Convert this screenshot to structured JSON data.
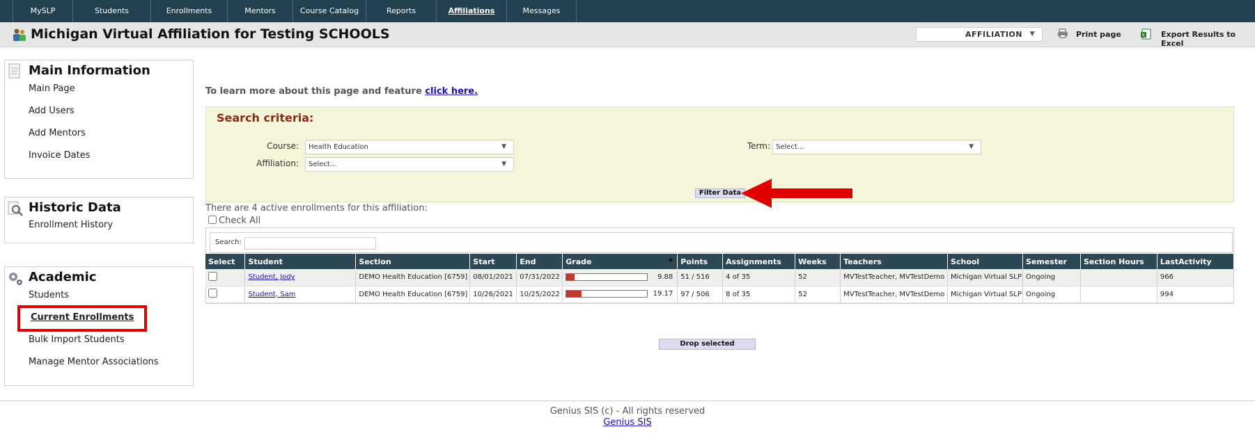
{
  "nav": {
    "tabs": [
      {
        "label": "MySLP"
      },
      {
        "label": "Students"
      },
      {
        "label": "Enrollments"
      },
      {
        "label": "Mentors"
      },
      {
        "label": "Course Catalog"
      },
      {
        "label": "Reports"
      },
      {
        "label": "Affiliations",
        "active": true
      },
      {
        "label": "Messages"
      }
    ]
  },
  "header": {
    "title": "Michigan Virtual Affiliation for Testing SCHOOLS",
    "affiliation_select": "AFFILIATION",
    "print_label": "Print page",
    "export_label": "Export Results to Excel"
  },
  "sidebar": {
    "main": {
      "title": "Main Information",
      "items": [
        "Main Page",
        "Add Users",
        "Add Mentors",
        "Invoice Dates"
      ]
    },
    "historic": {
      "title": "Historic Data",
      "items": [
        "Enrollment History"
      ]
    },
    "academic": {
      "title": "Academic",
      "items": [
        "Students",
        "Current Enrollments",
        "Bulk Import Students",
        "Manage Mentor Associations"
      ]
    }
  },
  "main": {
    "learn_text": "To learn more about this page and feature",
    "learn_link": "click here.",
    "search": {
      "heading": "Search criteria:",
      "course_label": "Course:",
      "course_value": "Health Education",
      "term_label": "Term:",
      "term_value": "Select...",
      "affiliation_label": "Affiliation:",
      "affiliation_value": "Select...",
      "filter_button": "Filter Data"
    },
    "count_text": "There are 4 active enrollments for this affiliation:",
    "check_all": "Check All",
    "table_search_label": "Search:",
    "columns": [
      "Select",
      "Student",
      "Section",
      "Start",
      "End",
      "Grade",
      "Points",
      "Assignments",
      "Weeks",
      "Teachers",
      "School",
      "Semester",
      "Section Hours",
      "LastActivity"
    ],
    "rows": [
      {
        "student": "Student, Jody",
        "section": "DEMO Health Education [6759]",
        "start": "08/01/2021",
        "end": "07/31/2022",
        "grade": "9.88",
        "grade_pct": 9.88,
        "points": "51 / 516",
        "assignments": "4 of 35",
        "weeks": "52",
        "teachers": "MVTestTeacher, MVTestDemo",
        "school": "Michigan Virtual SLP",
        "semester": "Ongoing",
        "section_hours": "",
        "last_activity": "966"
      },
      {
        "student": "Student, Sam",
        "section": "DEMO Health Education [6759]",
        "start": "10/26/2021",
        "end": "10/25/2022",
        "grade": "19.17",
        "grade_pct": 19.17,
        "points": "97 / 506",
        "assignments": "8 of 35",
        "weeks": "52",
        "teachers": "MVTestTeacher, MVTestDemo",
        "school": "Michigan Virtual SLP",
        "semester": "Ongoing",
        "section_hours": "",
        "last_activity": "994"
      }
    ],
    "drop_button": "Drop selected"
  },
  "footer": {
    "copyright": "Genius SIS (c) - All rights reserved",
    "link": "Genius SIS"
  },
  "colors": {
    "nav_bg": "#22404f",
    "table_header_bg": "#2c4857",
    "search_bg": "#f5f5d9",
    "highlight_red": "#e00000",
    "grade_fill": "#c0392b"
  }
}
